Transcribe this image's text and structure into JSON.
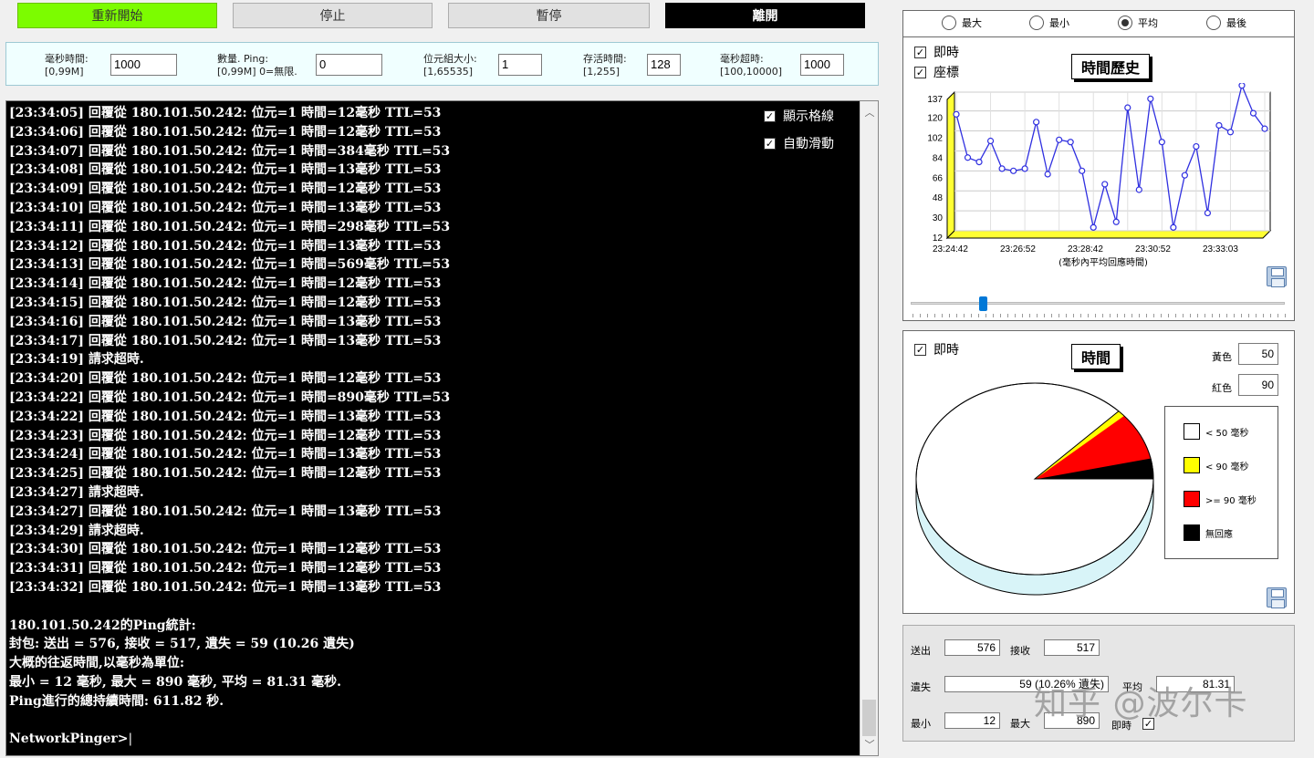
{
  "toolbar": {
    "restart": "重新開始",
    "stop": "停止",
    "pause": "暫停",
    "leave": "離開"
  },
  "params": [
    {
      "label1": "毫秒時間:",
      "label2": "[0,99M]",
      "value": "1000"
    },
    {
      "label1": "數量. Ping:",
      "label2": "[0,99M] 0=無限.",
      "value": "0"
    },
    {
      "label1": "位元組大小:",
      "label2": "[1,65535]",
      "value": "1"
    },
    {
      "label1": "存活時間:",
      "label2": "[1,255]",
      "value": "128"
    },
    {
      "label1": "毫秒超時:",
      "label2": "[100,10000]",
      "value": "1000"
    }
  ],
  "console": {
    "lines": [
      "[23:34:05] 回覆從 180.101.50.242: 位元=1 時間=12毫秒 TTL=53",
      "[23:34:06] 回覆從 180.101.50.242: 位元=1 時間=12毫秒 TTL=53",
      "[23:34:07] 回覆從 180.101.50.242: 位元=1 時間=384毫秒 TTL=53",
      "[23:34:08] 回覆從 180.101.50.242: 位元=1 時間=13毫秒 TTL=53",
      "[23:34:09] 回覆從 180.101.50.242: 位元=1 時間=12毫秒 TTL=53",
      "[23:34:10] 回覆從 180.101.50.242: 位元=1 時間=13毫秒 TTL=53",
      "[23:34:11] 回覆從 180.101.50.242: 位元=1 時間=298毫秒 TTL=53",
      "[23:34:12] 回覆從 180.101.50.242: 位元=1 時間=13毫秒 TTL=53",
      "[23:34:13] 回覆從 180.101.50.242: 位元=1 時間=569毫秒 TTL=53",
      "[23:34:14] 回覆從 180.101.50.242: 位元=1 時間=12毫秒 TTL=53",
      "[23:34:15] 回覆從 180.101.50.242: 位元=1 時間=12毫秒 TTL=53",
      "[23:34:16] 回覆從 180.101.50.242: 位元=1 時間=13毫秒 TTL=53",
      "[23:34:17] 回覆從 180.101.50.242: 位元=1 時間=13毫秒 TTL=53",
      "[23:34:19] 請求超時.",
      "[23:34:20] 回覆從 180.101.50.242: 位元=1 時間=12毫秒 TTL=53",
      "[23:34:22] 回覆從 180.101.50.242: 位元=1 時間=890毫秒 TTL=53",
      "[23:34:22] 回覆從 180.101.50.242: 位元=1 時間=13毫秒 TTL=53",
      "[23:34:23] 回覆從 180.101.50.242: 位元=1 時間=12毫秒 TTL=53",
      "[23:34:24] 回覆從 180.101.50.242: 位元=1 時間=13毫秒 TTL=53",
      "[23:34:25] 回覆從 180.101.50.242: 位元=1 時間=12毫秒 TTL=53",
      "[23:34:27] 請求超時.",
      "[23:34:27] 回覆從 180.101.50.242: 位元=1 時間=13毫秒 TTL=53",
      "[23:34:29] 請求超時.",
      "[23:34:30] 回覆從 180.101.50.242: 位元=1 時間=12毫秒 TTL=53",
      "[23:34:31] 回覆從 180.101.50.242: 位元=1 時間=12毫秒 TTL=53",
      "[23:34:32] 回覆從 180.101.50.242: 位元=1 時間=13毫秒 TTL=53",
      "",
      "180.101.50.242的Ping統計:",
      "封包: 送出 = 576, 接收 = 517, 遺失 = 59 (10.26 遺失)",
      "大概的往返時間,以毫秒為單位:",
      "最小 = 12 毫秒, 最大 = 890 毫秒, 平均 = 81.31 毫秒.",
      "Ping進行的總持續時間: 611.82 秒.",
      "",
      "NetworkPinger>"
    ],
    "show_grid": "顯示格線",
    "auto_scroll": "自動滑動"
  },
  "history": {
    "radios": [
      "最大",
      "最小",
      "平均",
      "最後"
    ],
    "selected": "平均",
    "realtime": "即時",
    "coords": "座標",
    "title": "時間歷史",
    "xlabel": "(毫秒內平均回應時間)"
  },
  "chart_data": [
    {
      "type": "line",
      "title": "時間歷史",
      "xlabel": "(毫秒內平均回應時間)",
      "ylabel": "",
      "yticks": [
        "12",
        "30",
        "48",
        "66",
        "84",
        "102",
        "120",
        "137"
      ],
      "xticks": [
        "23:24:42",
        "23:26:52",
        "23:28:42",
        "23:30:52",
        "23:33:03"
      ],
      "ylim": [
        12,
        137
      ],
      "values": [
        117,
        78,
        74,
        93,
        68,
        66,
        68,
        110,
        63,
        94,
        92,
        66,
        15,
        54,
        20,
        123,
        49,
        131,
        92,
        15,
        62,
        88,
        28,
        107,
        101,
        143,
        118,
        104
      ],
      "grid": true
    },
    {
      "type": "pie",
      "title": "時間",
      "slices": [
        {
          "label": "< 50 毫秒",
          "value": 87.5,
          "color": "#ffffff"
        },
        {
          "label": "< 90 毫秒",
          "value": 1.0,
          "color": "#ffff00"
        },
        {
          "label": ">= 90 毫秒",
          "value": 8.0,
          "color": "#ff0000"
        },
        {
          "label": "無回應",
          "value": 3.5,
          "color": "#000000"
        }
      ],
      "legend": "right"
    }
  ],
  "pie": {
    "realtime": "即時",
    "title": "時間",
    "yellow_label": "黃色",
    "yellow_value": "50",
    "red_label": "紅色",
    "red_value": "90",
    "legend": [
      "< 50 毫秒",
      "< 90 毫秒",
      ">= 90 毫秒",
      "無回應"
    ]
  },
  "stats": {
    "sent_label": "送出",
    "sent": "576",
    "recv_label": "接收",
    "recv": "517",
    "lost_label": "遺失",
    "lost": "59 (10.26% 遺失)",
    "avg_label": "平均",
    "avg": "81.31",
    "min_label": "最小",
    "min": "12",
    "max_label": "最大",
    "max": "890",
    "rt_label": "即時"
  },
  "watermark": "知乎 @波尔卡"
}
